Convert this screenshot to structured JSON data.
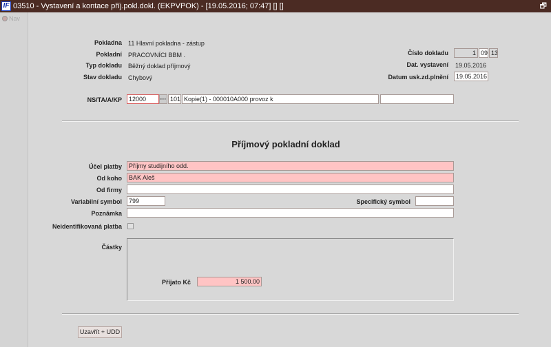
{
  "window": {
    "title": "03510 - Vystavení a kontace příj.pokl.dokl. (EKPVPOK) - [19.05.2016; 07:47]  []  []",
    "logo": "IF",
    "restore_icon": "restore-icon"
  },
  "sidebar": {
    "nav_label": "Nav"
  },
  "header": {
    "pokladna_label": "Pokladna",
    "pokladna_value": "11 Hlavní pokladna - zástup",
    "pokladni_label": "Pokladní",
    "pokladni_value": "PRACOVNÍCI BBM .",
    "typ_label": "Typ dokladu",
    "typ_value": "Běžný doklad příjmový",
    "stav_label": "Stav dokladu",
    "stav_value": "Chybový",
    "cislo_label": "Číslo dokladu",
    "cislo_1": "1",
    "cislo_2": "09",
    "cislo_3": "13",
    "dat_vyst_label": "Dat. vystavení",
    "dat_vyst_value": "19.05.2016",
    "datum_usk_label": "Datum usk.zd.plnění",
    "datum_usk_value": "19.05.2016"
  },
  "ns": {
    "label": "NS/TA/A/KP",
    "ns": "12000",
    "lookup": "···",
    "ta": "101",
    "a": "Kopie(1) - 000010A000 provoz k",
    "kp": ""
  },
  "form": {
    "title": "Příjmový pokladní doklad",
    "ucel_label": "Účel platby",
    "ucel_value": "Příjmy studijního odd.",
    "odkoho_label": "Od koho",
    "odkoho_value": "BAK Aleš",
    "odfirmy_label": "Od firmy",
    "odfirmy_value": "",
    "vs_label": "Variabilní symbol",
    "vs_value": "799",
    "ss_label": "Specifický symbol",
    "ss_value": "",
    "poznamka_label": "Poznámka",
    "poznamka_value": "",
    "neident_label": "Neidentifikovaná platba",
    "castky_label": "Částky",
    "prijato_label": "Přijato Kč",
    "prijato_value": "1 500.00"
  },
  "footer": {
    "button": "Uzavřít + UDD"
  }
}
